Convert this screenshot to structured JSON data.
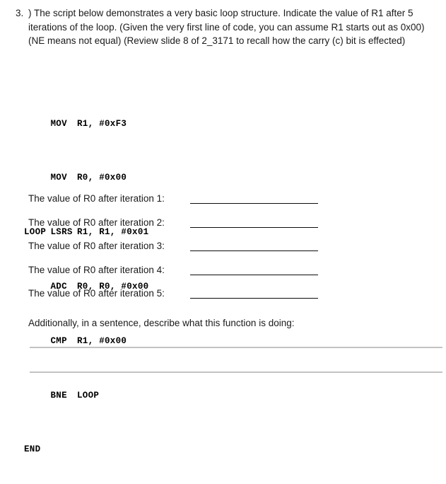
{
  "question": {
    "number": "3.",
    "text": ") The script below demonstrates a very basic loop structure. Indicate the value of R1 after 5 iterations of the loop. (Given the very first line of code, you can assume R1 starts out as 0x00) (NE means not equal) (Review slide 8 of 2_3171 to recall how the carry (c) bit is effected)"
  },
  "code": {
    "lines": [
      {
        "label": "",
        "mnemonic": "MOV",
        "operands": "R1, #0xF3"
      },
      {
        "label": "",
        "mnemonic": "MOV",
        "operands": "R0, #0x00"
      },
      {
        "label": "LOOP",
        "mnemonic": "LSRS",
        "operands": "R1, R1, #0x01"
      },
      {
        "label": "",
        "mnemonic": "ADC",
        "operands": "R0, R0, #0x00"
      },
      {
        "label": "",
        "mnemonic": "CMP",
        "operands": "R1, #0x00"
      },
      {
        "label": "",
        "mnemonic": "BNE",
        "operands": "LOOP"
      },
      {
        "label": "END",
        "mnemonic": "",
        "operands": ""
      }
    ]
  },
  "answers": {
    "rows": [
      {
        "label": "The value of R0 after iteration 1:",
        "value": ""
      },
      {
        "label": "The value of R0 after iteration 2:",
        "value": ""
      },
      {
        "label": "The value of R0 after iteration 3:",
        "value": ""
      },
      {
        "label": "The value of R0 after iteration 4:",
        "value": ""
      },
      {
        "label": "The value of R0 after iteration 5:",
        "value": ""
      }
    ]
  },
  "closing": {
    "prompt": "Additionally, in a sentence, describe what this function is doing:",
    "writing_lines": [
      "",
      ""
    ]
  },
  "colors": {
    "text": "#1a1a1a",
    "code_text": "#000000",
    "answer_rule": "#0d0d0d",
    "writing_rule": "#c3c3c3",
    "background": "#ffffff"
  }
}
